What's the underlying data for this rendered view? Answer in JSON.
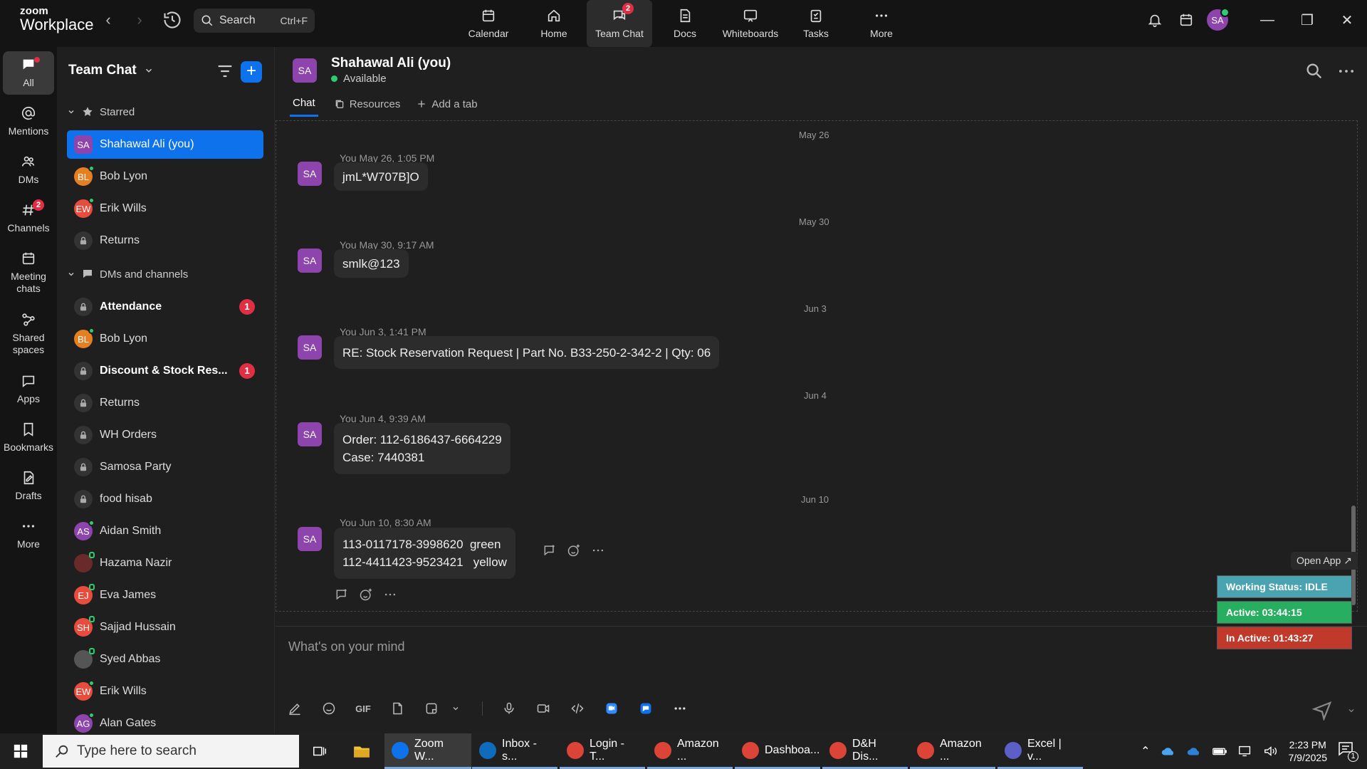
{
  "app": {
    "logo_line1": "zoom",
    "logo_line2": "Workplace"
  },
  "search": {
    "label": "Search",
    "shortcut": "Ctrl+F"
  },
  "topnav": [
    {
      "label": "Calendar",
      "icon": "calendar-icon"
    },
    {
      "label": "Home",
      "icon": "home-icon"
    },
    {
      "label": "Team Chat",
      "icon": "chat-icon",
      "badge": "2",
      "active": true
    },
    {
      "label": "Docs",
      "icon": "docs-icon"
    },
    {
      "label": "Whiteboards",
      "icon": "whiteboard-icon"
    },
    {
      "label": "Tasks",
      "icon": "tasks-icon"
    },
    {
      "label": "More",
      "icon": "more-icon"
    }
  ],
  "user": {
    "initials": "SA"
  },
  "rail": [
    {
      "label": "All",
      "active": true
    },
    {
      "label": "Mentions"
    },
    {
      "label": "DMs"
    },
    {
      "label": "Channels",
      "badge": "2"
    },
    {
      "label": "Meeting chats"
    },
    {
      "label": "Shared spaces"
    },
    {
      "label": "Apps"
    },
    {
      "label": "Bookmarks"
    },
    {
      "label": "Drafts"
    },
    {
      "label": "More"
    }
  ],
  "sidebar": {
    "title": "Team Chat",
    "starred_label": "Starred",
    "starred": [
      {
        "name": "Shahawal Ali (you)",
        "initials": "SA",
        "color": "#8e44ad",
        "type": "user",
        "selected": true
      },
      {
        "name": "Bob Lyon",
        "initials": "BL",
        "color": "#e67e22",
        "type": "user",
        "status": "online"
      },
      {
        "name": "Erik Wills",
        "initials": "EW",
        "color": "#e74c3c",
        "type": "user",
        "status": "online"
      },
      {
        "name": "Returns",
        "type": "channel"
      }
    ],
    "dms_label": "DMs and channels",
    "dms": [
      {
        "name": "Attendance",
        "type": "channel",
        "bold": true,
        "badge": "1"
      },
      {
        "name": "Bob Lyon",
        "initials": "BL",
        "color": "#e67e22",
        "type": "user",
        "status": "online"
      },
      {
        "name": "Discount & Stock Res...",
        "type": "channel",
        "bold": true,
        "badge": "1"
      },
      {
        "name": "Returns",
        "type": "channel"
      },
      {
        "name": "WH Orders",
        "type": "channel"
      },
      {
        "name": "Samosa Party",
        "type": "channel"
      },
      {
        "name": "food hisab",
        "type": "channel"
      },
      {
        "name": "Aidan Smith",
        "initials": "AS",
        "color": "#8e44ad",
        "type": "user",
        "status": "online"
      },
      {
        "name": "Hazama Nazir",
        "initials": "",
        "color": "#6b2a2a",
        "type": "user",
        "status": "offline"
      },
      {
        "name": "Eva James",
        "initials": "EJ",
        "color": "#e74c3c",
        "type": "user",
        "status": "offline"
      },
      {
        "name": "Sajjad Hussain",
        "initials": "SH",
        "color": "#e74c3c",
        "type": "user",
        "status": "offline"
      },
      {
        "name": "Syed Abbas",
        "initials": "",
        "color": "#555555",
        "type": "user",
        "status": "offline"
      },
      {
        "name": "Erik Wills",
        "initials": "EW",
        "color": "#e74c3c",
        "type": "user",
        "status": "online"
      },
      {
        "name": "Alan Gates",
        "initials": "AG",
        "color": "#8e44ad",
        "type": "user",
        "status": "online"
      }
    ]
  },
  "chat_header": {
    "initials": "SA",
    "name": "Shahawal Ali (you)",
    "status": "Available",
    "tabs": [
      "Chat",
      "Resources",
      "Add a tab"
    ]
  },
  "messages": [
    {
      "date": "May 26",
      "meta": "You May 26, 1:05 PM",
      "lines": [
        "jmL*W707B]O"
      ]
    },
    {
      "date": "May 30",
      "meta": "You May 30, 9:17 AM",
      "lines": [
        "smlk@123"
      ]
    },
    {
      "date": "Jun 3",
      "meta": "You Jun 3, 1:41 PM",
      "lines": [
        "RE: Stock Reservation Request | Part No. B33-250-2-342-2 | Qty: 06"
      ]
    },
    {
      "date": "Jun 4",
      "meta": "You Jun 4, 9:39 AM",
      "lines": [
        "Order: 112-6186437-6664229",
        "Case: 7440381"
      ]
    },
    {
      "date": "Jun 10",
      "meta": "You Jun 10, 8:30 AM",
      "lines": [
        "113-0117178-3998620  green",
        "112-4411423-9523421   yellow"
      ]
    }
  ],
  "composer": {
    "placeholder": "What's on your mind",
    "gif_label": "GIF"
  },
  "widget": {
    "open_app": "Open App ↗",
    "working_status": "Working Status: IDLE",
    "active": "Active: 03:44:15",
    "inactive": "In Active: 01:43:27",
    "colors": {
      "idle": "#4aa3b0",
      "active": "#27ae60",
      "inactive": "#c0392b"
    }
  },
  "taskbar": {
    "search_placeholder": "Type here to search",
    "items": [
      {
        "label": "Zoom W...",
        "color": "#0e72ed",
        "active": true
      },
      {
        "label": "Inbox - s...",
        "color": "#0f6cbd"
      },
      {
        "label": "Login - T...",
        "color": "#db4437"
      },
      {
        "label": "Amazon ...",
        "color": "#db4437"
      },
      {
        "label": "Dashboa...",
        "color": "#db4437"
      },
      {
        "label": "D&H Dis...",
        "color": "#db4437"
      },
      {
        "label": "Amazon ...",
        "color": "#db4437"
      },
      {
        "label": "Excel | v...",
        "color": "#5b5fc7"
      }
    ],
    "time": "2:23 PM",
    "date": "7/9/2025",
    "notif": "1"
  }
}
